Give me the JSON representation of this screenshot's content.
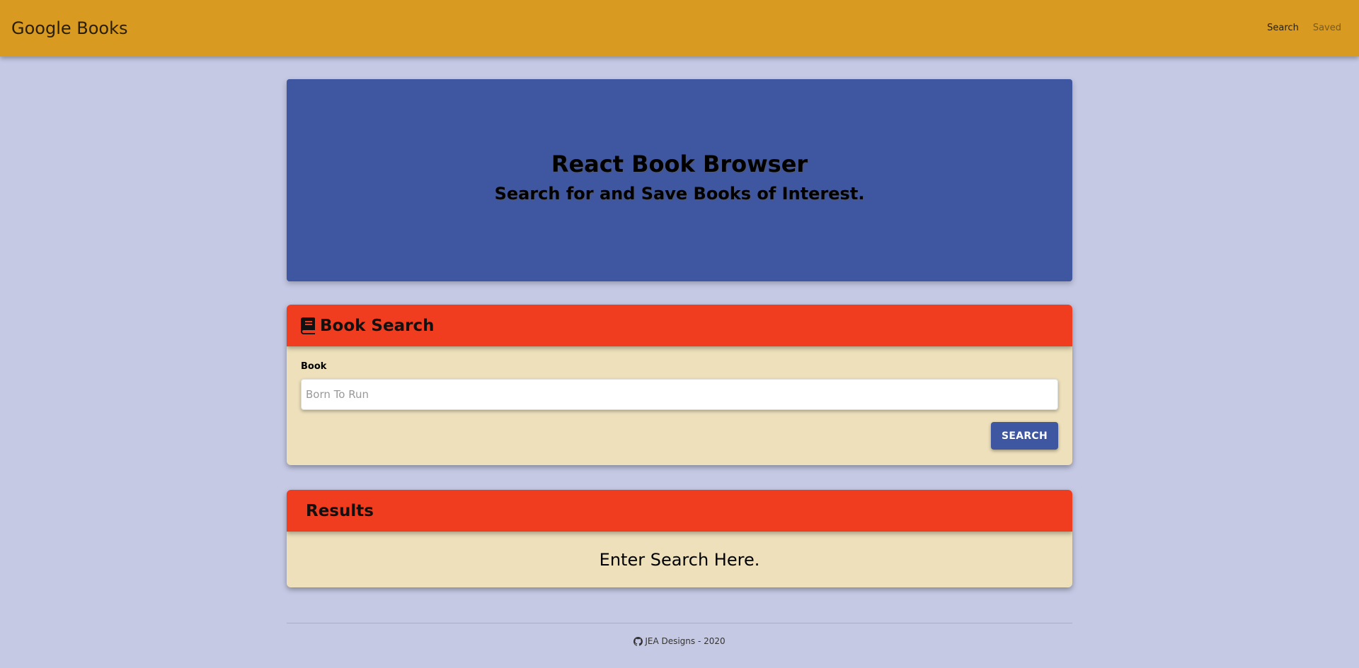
{
  "navbar": {
    "brand": "Google Books",
    "links": [
      {
        "label": "Search",
        "active": true
      },
      {
        "label": "Saved",
        "active": false
      }
    ]
  },
  "jumbotron": {
    "title": "React Book Browser",
    "subtitle": "Search for and Save Books of Interest."
  },
  "search_card": {
    "icon": "book-icon",
    "title": "Book Search",
    "field_label": "Book",
    "input_value": "",
    "input_placeholder": "Born To Run",
    "button_label": "SEARCH"
  },
  "results_card": {
    "title": "Results",
    "message": "Enter Search Here."
  },
  "footer": {
    "icon": "github-icon",
    "text": "JEA Designs - 2020"
  },
  "colors": {
    "page_background": "#c5c9e4",
    "navbar": "#d89a21",
    "jumbotron": "#3f56a0",
    "card_header": "#f03c1f",
    "card_body": "#ede0bb",
    "button": "#3f56a0"
  }
}
